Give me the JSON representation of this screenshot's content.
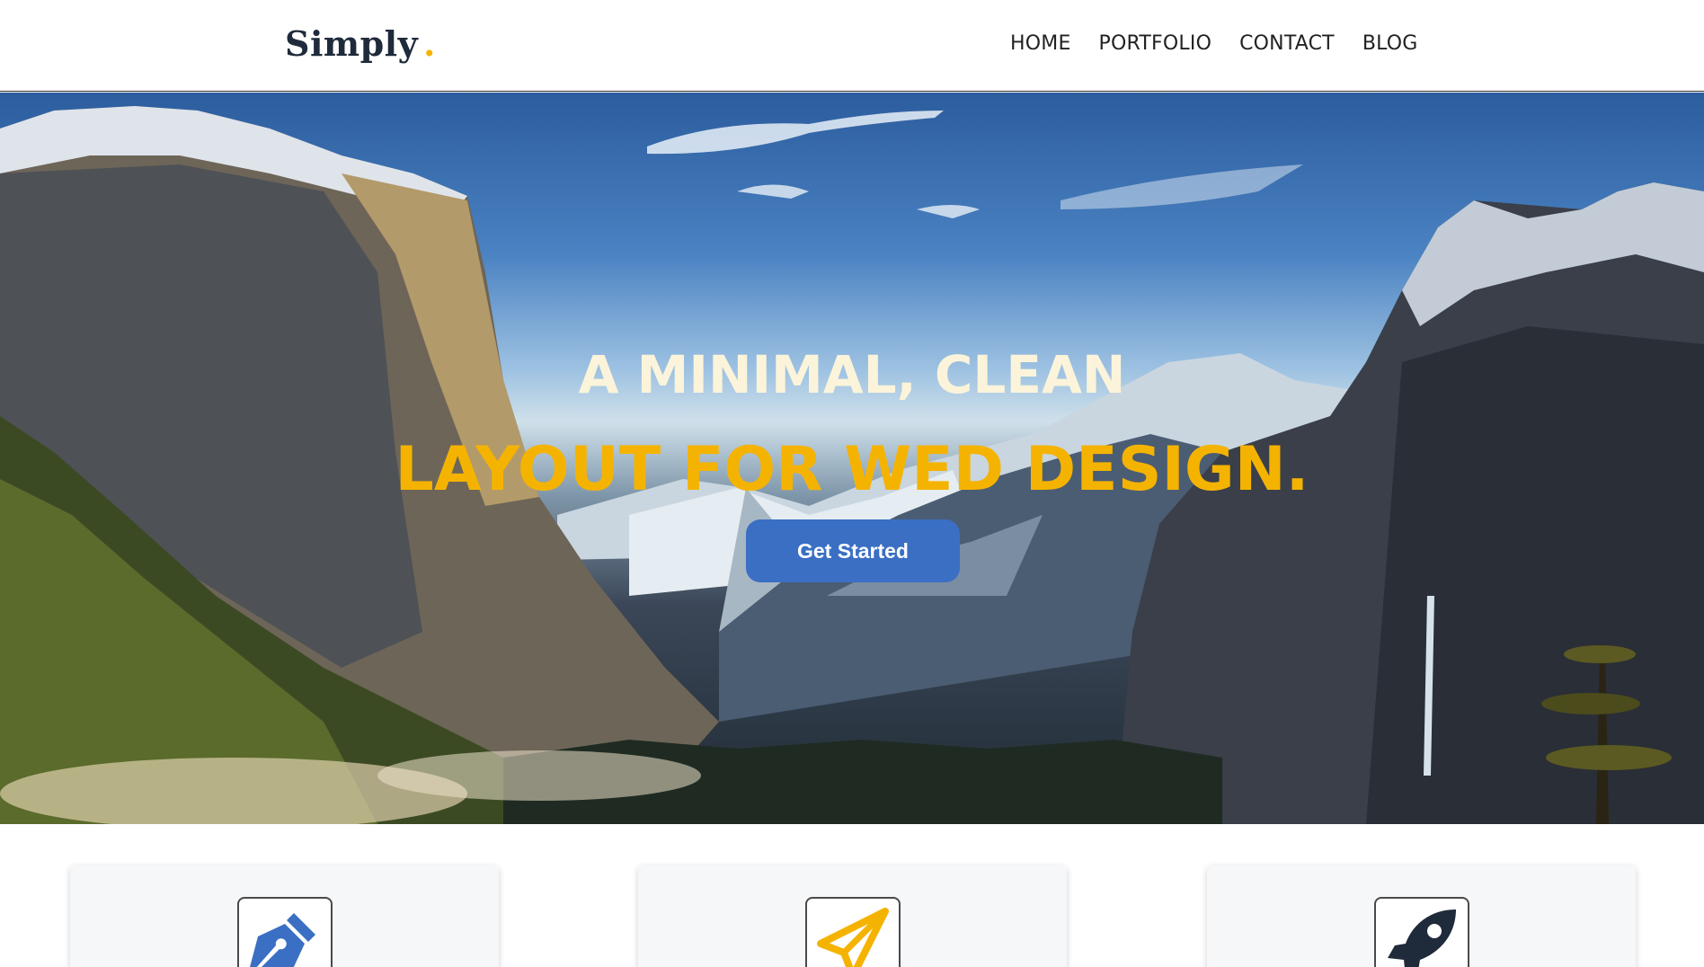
{
  "header": {
    "logo_text": "Simply",
    "logo_dot": ".",
    "nav": [
      "HOME",
      "PORTFOLIO",
      "CONTACT",
      "BLOG"
    ]
  },
  "hero": {
    "title_line1": "A MINIMAL, CLEAN",
    "title_line2": "LAYOUT FOR WED DESIGN.",
    "cta_label": "Get Started"
  },
  "features": {
    "cards": [
      {
        "icon": "pen-nib-icon",
        "color": "#3a6fc4"
      },
      {
        "icon": "paper-plane-icon",
        "color": "#f5b301"
      },
      {
        "icon": "rocket-icon",
        "color": "#1f2a3a"
      }
    ]
  },
  "colors": {
    "accent_yellow": "#f5b301",
    "accent_blue": "#3a6fc4",
    "dark": "#1f2a3a"
  }
}
